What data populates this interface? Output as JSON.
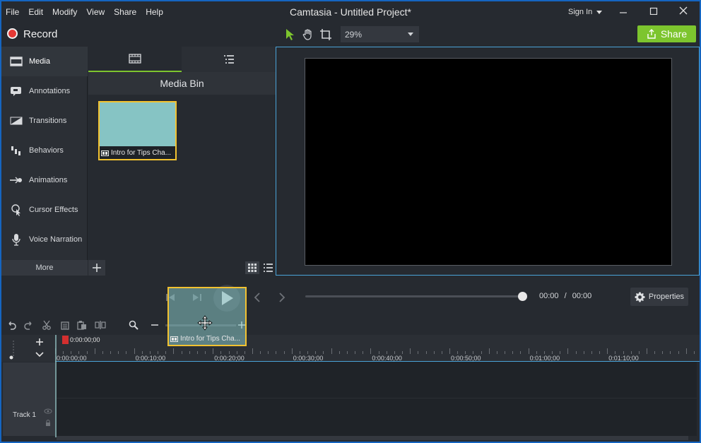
{
  "menu": [
    "File",
    "Edit",
    "Modify",
    "View",
    "Share",
    "Help"
  ],
  "window_title": "Camtasia - Untitled Project*",
  "sign_in": "Sign In",
  "record_label": "Record",
  "zoom_value": "29%",
  "share_label": "Share",
  "tools": [
    {
      "label": "Media",
      "icon": "film-icon"
    },
    {
      "label": "Annotations",
      "icon": "annotation-icon"
    },
    {
      "label": "Transitions",
      "icon": "transition-icon"
    },
    {
      "label": "Behaviors",
      "icon": "behaviors-icon"
    },
    {
      "label": "Animations",
      "icon": "animation-icon"
    },
    {
      "label": "Cursor Effects",
      "icon": "cursor-effects-icon"
    },
    {
      "label": "Voice Narration",
      "icon": "microphone-icon"
    }
  ],
  "more_label": "More",
  "media_bin_title": "Media Bin",
  "clip_name": "Intro for Tips Cha...",
  "time_current": "00:00",
  "time_sep": "/",
  "time_total": "00:00",
  "properties_label": "Properties",
  "playhead_time": "0:00:00;00",
  "ruler_labels": [
    "0:00:00;00",
    "0:00:10;00",
    "0:00:20;00",
    "0:00:30;00",
    "0:00:40;00",
    "0:00:50;00",
    "0:01:00;00",
    "0:01:10;00"
  ],
  "track_label": "Track 1"
}
